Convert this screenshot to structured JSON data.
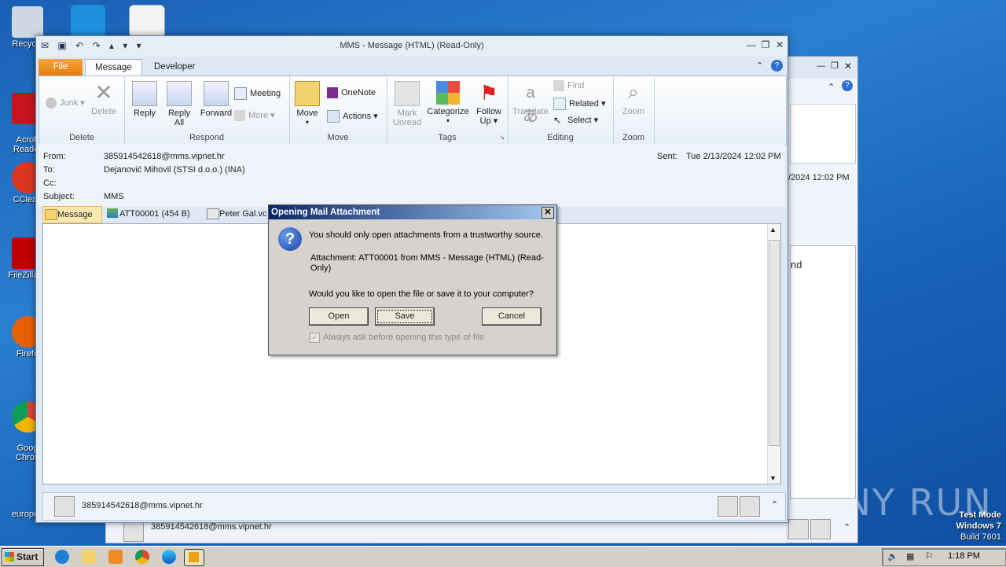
{
  "desktop": {
    "icons": [
      {
        "label": "Recycle",
        "icon": "recycle-bin-icon"
      },
      {
        "label": "Acrob\nReader",
        "icon": "acrobat-icon"
      },
      {
        "label": "CClean",
        "icon": "ccleaner-icon"
      },
      {
        "label": "FileZilla C",
        "icon": "filezilla-icon"
      },
      {
        "label": "Firefo",
        "icon": "firefox-icon"
      },
      {
        "label": "Goog\nChron",
        "icon": "chrome-icon"
      },
      {
        "label": "europea",
        "icon": "file-icon"
      }
    ]
  },
  "window": {
    "title": "MMS  -  Message (HTML) (Read-Only)",
    "tabs": {
      "file": "File",
      "message": "Message",
      "developer": "Developer"
    },
    "ribbon": {
      "delete_group": {
        "label": "Delete",
        "junk": "Junk",
        "delete": "Delete"
      },
      "respond_group": {
        "label": "Respond",
        "reply": "Reply",
        "reply_all_1": "Reply",
        "reply_all_2": "All",
        "forward": "Forward",
        "meeting": "Meeting",
        "more": "More"
      },
      "move_group": {
        "label": "Move",
        "move": "Move",
        "onenote": "OneNote",
        "actions": "Actions"
      },
      "tags_group": {
        "label": "Tags",
        "mark_unread_1": "Mark",
        "mark_unread_2": "Unread",
        "categorize": "Categorize",
        "follow_up_1": "Follow",
        "follow_up_2": "Up"
      },
      "editing_group": {
        "label": "Editing",
        "translate": "Translate",
        "find": "Find",
        "related": "Related",
        "select": "Select"
      },
      "zoom_group": {
        "label": "Zoom",
        "zoom": "Zoom"
      }
    },
    "header": {
      "from_label": "From:",
      "from": "385914542618@mms.vipnet.hr",
      "to_label": "To:",
      "to": "Dejanović Mihovil (STSI d.o.o.) (INA)",
      "cc_label": "Cc:",
      "subject_label": "Subject:",
      "subject": "MMS",
      "sent_label": "Sent:",
      "sent": "Tue 2/13/2024 12:02 PM"
    },
    "attachments": [
      {
        "label": "Message"
      },
      {
        "label": "ATT00001 (454 B)"
      },
      {
        "label": "Peter Gal.vc"
      }
    ],
    "people_pane": {
      "sender": "385914542618@mms.vipnet.hr"
    }
  },
  "back_window": {
    "sent_fragment": "/2024 12:02 PM",
    "body_fragment": "nd",
    "sender": "385914542618@mms.vipnet.hr"
  },
  "dialog": {
    "title": "Opening Mail Attachment",
    "warning": "You should only open attachments from a trustworthy source.",
    "attachment_info_1": "Attachment: ATT00001 from MMS - Message (HTML) (Read-",
    "attachment_info_2": "Only)",
    "question": "Would you like to open the file or save it to your computer?",
    "open": "Open",
    "save": "Save",
    "cancel": "Cancel",
    "checkbox": "Always ask before opening this type of file"
  },
  "taskbar": {
    "start": "Start",
    "time": "1:18 PM"
  },
  "watermark": {
    "line1": "Test Mode",
    "line2": "Windows 7",
    "line3": "Build 7601",
    "brand": "ANY RUN"
  }
}
